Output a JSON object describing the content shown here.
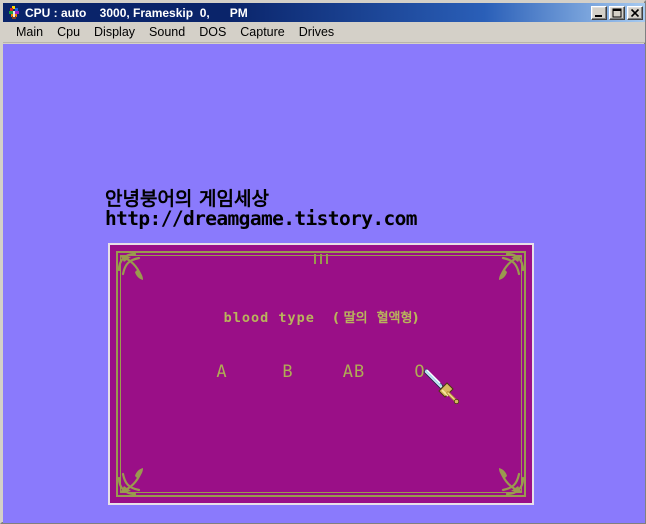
{
  "window": {
    "title": "CPU : auto    3000, Frameskip  0,      PM",
    "icon_name": "dosbox-icon",
    "controls": {
      "minimize_label": "Minimize",
      "maximize_label": "Maximize",
      "close_label": "Close"
    },
    "colors": {
      "titlebar_start": "#0a246a",
      "titlebar_end": "#a6caf0",
      "chrome": "#d4d0c8",
      "canvas_background": "#8a7afc",
      "panel_background": "#9a0f87",
      "ornament": "#9a9a4e",
      "game_text": "#b9b35c"
    }
  },
  "menubar": {
    "items": [
      {
        "label": "Main"
      },
      {
        "label": "Cpu"
      },
      {
        "label": "Display"
      },
      {
        "label": "Sound"
      },
      {
        "label": "DOS"
      },
      {
        "label": "Capture"
      },
      {
        "label": "Drives"
      }
    ]
  },
  "watermark": {
    "korean_title": "안녕붕어의 게임세상",
    "url": "http://dreamgame.tistory.com"
  },
  "game": {
    "prompt_en": "blood type",
    "prompt_kr": "( 딸의  혈액형)",
    "options": [
      {
        "label": "A"
      },
      {
        "label": "B"
      },
      {
        "label": "AB"
      },
      {
        "label": "O"
      }
    ],
    "cursor_name": "sword-cursor"
  }
}
